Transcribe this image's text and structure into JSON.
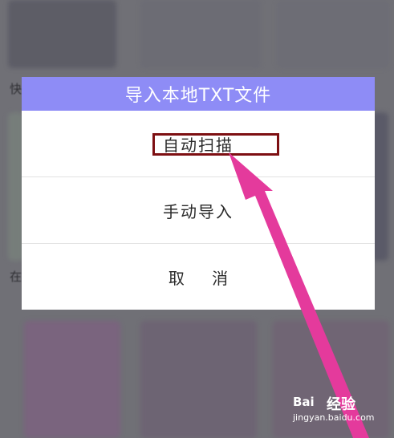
{
  "background": {
    "label_top": "快",
    "label_middle": "在"
  },
  "dialog": {
    "title": "导入本地TXT文件",
    "options": [
      {
        "label": "自动扫描"
      },
      {
        "label": "手动导入"
      },
      {
        "label": "取 消"
      }
    ]
  },
  "watermark": {
    "logo_text": "Bai",
    "brand": "经验",
    "url": "jingyan.baidu.com"
  },
  "colors": {
    "header": "#8e8cf6",
    "highlight": "#7d0f12",
    "arrow": "#e43a9c"
  }
}
